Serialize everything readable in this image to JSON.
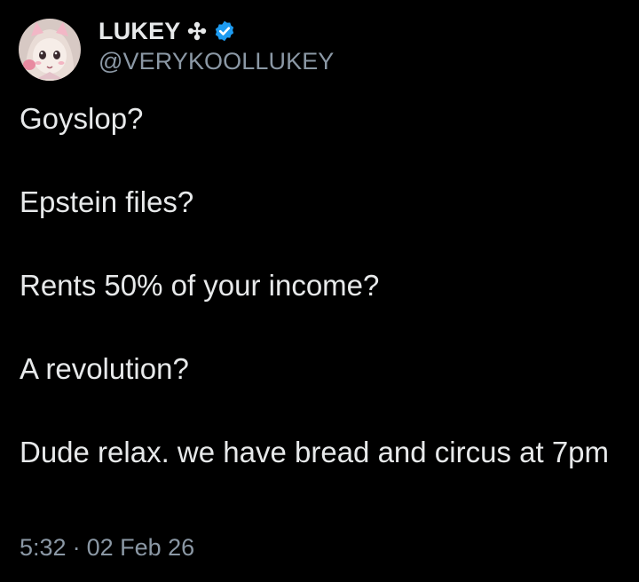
{
  "author": {
    "display_name": "LUKEY",
    "handle": "@VERYKOOLLUKEY",
    "verified": true,
    "name_icon": "sparkle-icon",
    "badge_icon": "verified-badge-icon",
    "badge_color": "#1d9bf0"
  },
  "tweet": {
    "paragraphs": [
      "Goyslop?",
      "Epstein files?",
      "Rents 50% of your income?",
      "A revolution?",
      "Dude relax. we have bread and circus at 7pm"
    ],
    "time": "5:32",
    "separator": "·",
    "date": "02 Feb 26"
  },
  "colors": {
    "background": "#000000",
    "text_primary": "#e7e9ea",
    "text_secondary": "#8b98a5"
  }
}
